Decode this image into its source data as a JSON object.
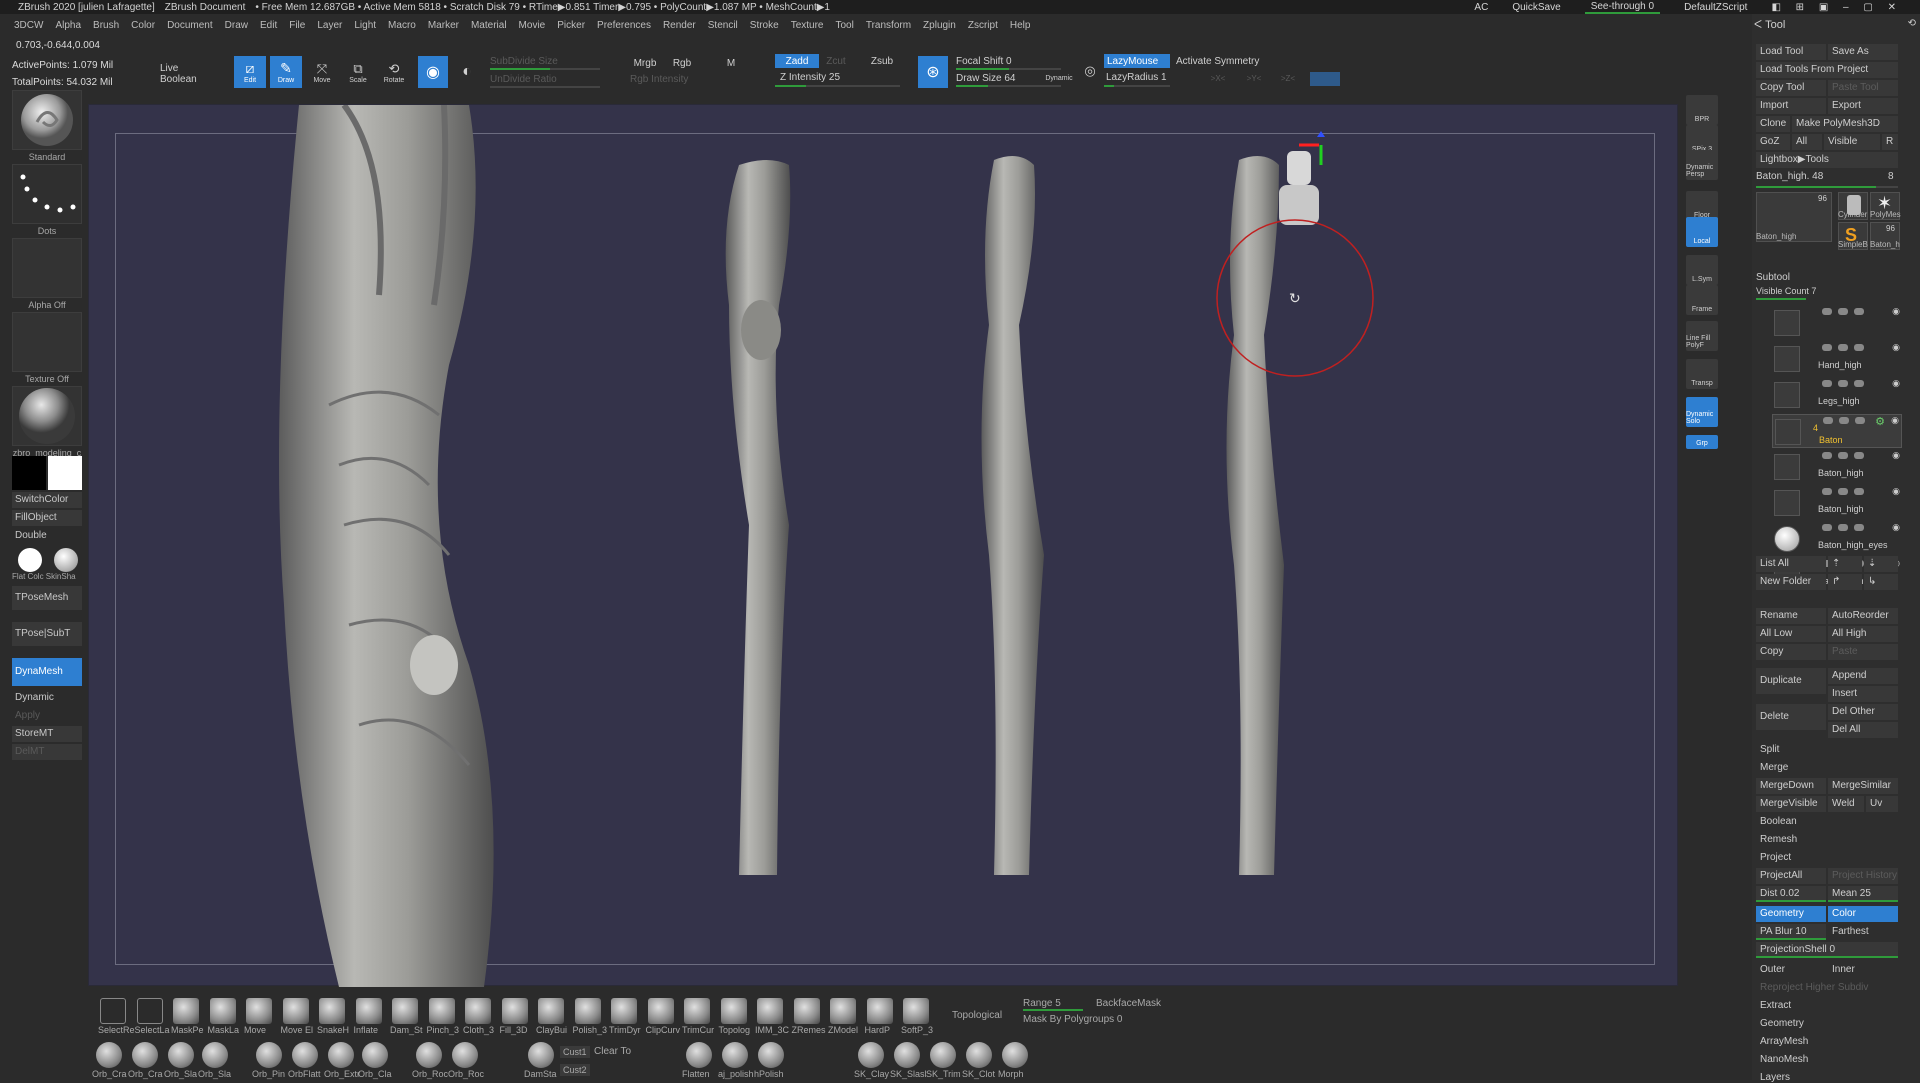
{
  "titlebar": {
    "app": "ZBrush 2020 [julien Lafragette]",
    "doc": "ZBrush Document",
    "stats": "• Free Mem 12.687GB • Active Mem 5818 • Scratch Disk 79 • RTime▶0.851 Timer▶0.795 • PolyCount▶1.087 MP • MeshCount▶1",
    "right": {
      "ac": "AC",
      "quicksave": "QuickSave",
      "seethrough": "See-through  0",
      "script": "DefaultZScript"
    }
  },
  "menu": [
    "3DCW",
    "Alpha",
    "Brush",
    "Color",
    "Document",
    "Draw",
    "Edit",
    "File",
    "Layer",
    "Light",
    "Macro",
    "Marker",
    "Material",
    "Movie",
    "Picker",
    "Preferences",
    "Render",
    "Stencil",
    "Stroke",
    "Texture",
    "Tool",
    "Transform",
    "Zplugin",
    "Zscript",
    "Help"
  ],
  "coords": "0.703,-0.644,0.004",
  "stats": {
    "active": "ActivePoints: 1.079 Mil",
    "total": "TotalPoints: 54.032 Mil"
  },
  "top": {
    "live_boolean": "Live Boolean",
    "edit": "Edit",
    "draw": "Draw",
    "move": "Move",
    "scale": "Scale",
    "rotate": "Rotate",
    "subdivide_size": "SubDivide Size",
    "undivide_ratio": "UnDivide Ratio",
    "mrgb": "Mrgb",
    "rgb": "Rgb",
    "m": "M",
    "rgb_intensity": "Rgb Intensity",
    "zadd": "Zadd",
    "zsub": "Zsub",
    "zcut": "Zcut",
    "z_intensity": "Z Intensity 25",
    "z_intensity_value": 0.25,
    "focal_shift": "Focal Shift 0",
    "focal_value": 0.5,
    "draw_size": "Draw Size 64",
    "draw_value": 0.3,
    "dynamic": "Dynamic",
    "lazymouse": "LazyMouse",
    "lazyradius": "LazyRadius 1",
    "activate_symmetry": "Activate Symmetry",
    "sym_x": ">X<",
    "sym_y": ">Y<",
    "sym_z": ">Z<"
  },
  "left": {
    "brush": "Standard",
    "stroke": "Dots",
    "alpha": "Alpha Off",
    "texture": "Texture Off",
    "material": "zbro_modeling_c",
    "switchcolor": "SwitchColor",
    "fillobject": "FillObject",
    "double": "Double",
    "flatcolor": "Flat Colc",
    "skinshade": "SkinSha",
    "tposemesh": "TPoseMesh",
    "tposesubt": "TPose|SubT",
    "dynamesh": "DynaMesh",
    "dynamic": "Dynamic",
    "apply": "Apply",
    "storemt": "StoreMT",
    "delmt": "DelMT"
  },
  "rstrip": [
    "BPR",
    "SPix 3",
    "Dynamic Persp",
    "Floor",
    "Local",
    "L.Sym",
    "Frame",
    "Line Fill PolyF",
    "Transp",
    "Dynamic Solo",
    "Grp"
  ],
  "tool": {
    "title": "Tool",
    "load_tool": "Load Tool",
    "save_as": "Save As",
    "load_from_project": "Load Tools From Project",
    "copy_tool": "Copy Tool",
    "paste_tool": "Paste Tool",
    "import": "Import",
    "export": "Export",
    "clone": "Clone",
    "make_polymesh": "Make PolyMesh3D",
    "goz": "GoZ",
    "all": "All",
    "visible": "Visible",
    "r": "R",
    "lightbox": "Lightbox▶Tools",
    "current": "Baton_high. 48",
    "current_n": "8",
    "thumbs": [
      {
        "label": "Baton_high",
        "badge": "96"
      },
      {
        "label": "Cylinder",
        "badge": ""
      },
      {
        "label": "PolyMes",
        "badge": ""
      },
      {
        "label": "SimpleB",
        "badge": ""
      },
      {
        "label": "Baton_h",
        "badge": "96"
      }
    ]
  },
  "subtool": {
    "title": "Subtool",
    "visible_count": "Visible Count 7",
    "items": [
      {
        "name": ""
      },
      {
        "name": "Hand_high"
      },
      {
        "name": "Legs_high"
      },
      {
        "name": "Baton",
        "count": "4",
        "selected": true
      },
      {
        "name": "Baton_high"
      },
      {
        "name": "Baton_high"
      },
      {
        "name": "Baton_high_eyes"
      },
      {
        "name": "Baton_high"
      }
    ],
    "list_all": "List All",
    "new_folder": "New Folder",
    "rename": "Rename",
    "autoreorder": "AutoReorder",
    "all_low": "All Low",
    "all_high": "All High",
    "copy": "Copy",
    "paste": "Paste",
    "duplicate": "Duplicate",
    "append": "Append",
    "insert": "Insert",
    "delete": "Delete",
    "del_other": "Del Other",
    "del_all": "Del All",
    "split": "Split",
    "merge": "Merge",
    "mergedown": "MergeDown",
    "mergesimilar": "MergeSimilar",
    "mergevisible": "MergeVisible",
    "weld": "Weld",
    "uv": "Uv",
    "boolean": "Boolean",
    "remesh": "Remesh",
    "project": "Project",
    "projectall": "ProjectAll",
    "project_history": "Project History",
    "dist": "Dist 0.02",
    "mean": "Mean 25",
    "geometry": "Geometry",
    "color": "Color",
    "pa_blur": "PA Blur 10",
    "farthest": "Farthest",
    "projectionshell": "ProjectionShell 0",
    "outer": "Outer",
    "inner": "Inner",
    "reproject": "Reproject Higher Subdiv",
    "extract": "Extract"
  },
  "submenus": [
    "Geometry",
    "ArrayMesh",
    "NanoMesh",
    "Layers"
  ],
  "bottom": {
    "row1": [
      "SelectRe",
      "SelectLa",
      "MaskPe",
      "MaskLa",
      "Move",
      "Move El",
      "SnakeH",
      "Inflate",
      "Dam_St",
      "Pinch_3",
      "Cloth_3",
      "Fill_3D",
      "ClayBui",
      "Polish_3",
      "TrimDyr",
      "ClipCurv",
      "TrimCur",
      "Topolog",
      "IMM_3C",
      "ZRemes",
      "ZModel",
      "HardP",
      "SoftP_3"
    ],
    "topological": "Topological",
    "range": "Range 5",
    "backfacemask": "BackfaceMask",
    "mask_polygroups": "Mask By Polygroups 0",
    "row2": [
      "Orb_Cra",
      "Orb_Cra",
      "Orb_Sla",
      "Orb_Sla",
      "Orb_Pin",
      "OrbFlatt",
      "Orb_Extr",
      "Orb_Cla",
      "Orb_Roc",
      "Orb_Roc",
      "DamSta",
      "Flatten",
      "aj_polish",
      "hPolish",
      "SK_Clay",
      "SK_Slasl",
      "SK_Trim",
      "SK_Clot",
      "Morph"
    ],
    "cust1": "Cust1",
    "cust2": "Cust2",
    "clear_to": "Clear To"
  },
  "colors": {
    "accent": "#2e7fd1",
    "green": "#2f9b3b",
    "viewport": "#34334a",
    "panel": "#2e2e2e"
  },
  "gizmo": "rotate-icon"
}
